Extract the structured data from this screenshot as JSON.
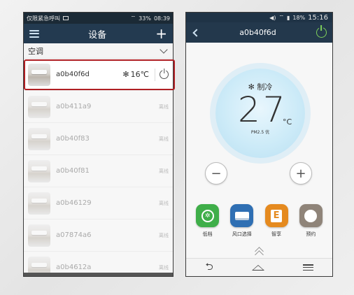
{
  "left": {
    "statusbar": {
      "carrier": "仅限紧急呼叫",
      "battery": "33%",
      "time": "08:39"
    },
    "navbar": {
      "title": "设备"
    },
    "section": {
      "title": "空调"
    },
    "active_device": {
      "name": "a0b40f6d",
      "temperature": "16℃",
      "mode_icon": "snowflake-icon"
    },
    "devices": [
      {
        "name": "a0b411a9",
        "status": "离线"
      },
      {
        "name": "a0b40f83",
        "status": "离线"
      },
      {
        "name": "a0b40f81",
        "status": "离线"
      },
      {
        "name": "a0b46129",
        "status": "离线"
      },
      {
        "name": "a07874a6",
        "status": "离线"
      },
      {
        "name": "a0b4612a",
        "status": "离线"
      }
    ],
    "highlight_color": "#b01f24"
  },
  "right": {
    "statusbar": {
      "battery": "18%",
      "time": "15:16"
    },
    "navbar": {
      "title": "a0b40f6d"
    },
    "dial": {
      "mode": "制冷",
      "temperature": "27",
      "unit": "°C",
      "pm_label": "PM2.5 优"
    },
    "functions": [
      {
        "label": "低档",
        "color": "#3fae49",
        "icon": "fan-icon"
      },
      {
        "label": "风口选择",
        "color": "#2f6fb3",
        "icon": "vent-icon"
      },
      {
        "label": "智享",
        "color": "#e58a1f",
        "icon": "smart-e-icon"
      },
      {
        "label": "预约",
        "color": "#8f8479",
        "icon": "alarm-clock-icon"
      }
    ],
    "accent_green": "#7fd15c"
  }
}
